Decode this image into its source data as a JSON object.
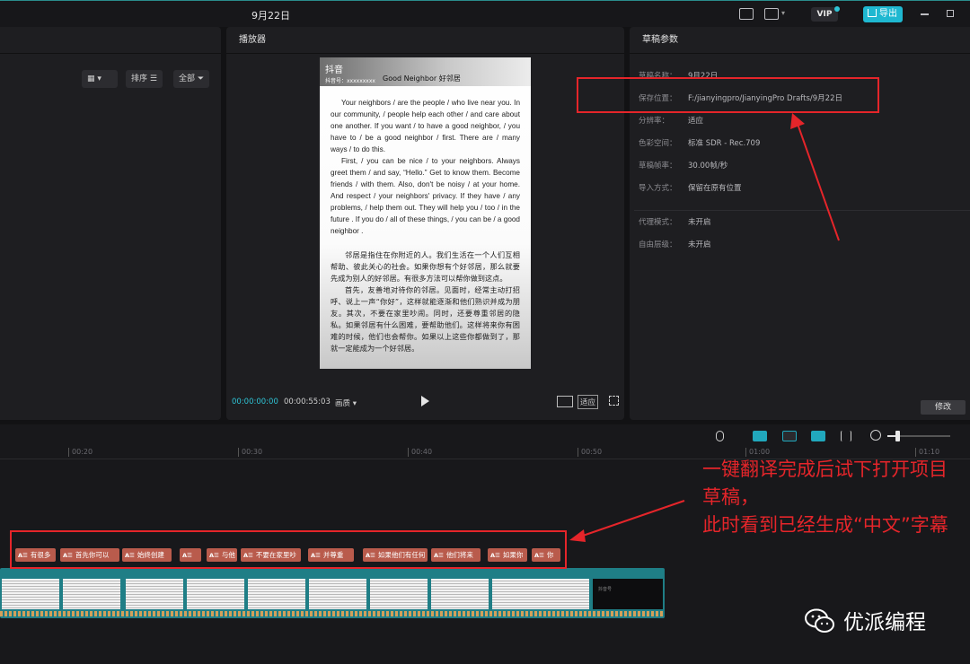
{
  "app": {
    "title": "9月22日",
    "export_label": "导出",
    "vip_label": "VIP"
  },
  "left_panel": {
    "sort_label": "排序",
    "all_label": "全部"
  },
  "player": {
    "title": "播放器",
    "time_current": "00:00:00:00",
    "time_total": "00:00:55:03",
    "quality_label": "画质",
    "fit_label": "适应"
  },
  "preview": {
    "logo": "抖音",
    "user_id": "抖音号：xxxxxxxxx",
    "heading": "Good Neighbor  好邻居",
    "en_para1": "Your neighbors / are the people / who live near you. In our community, / people help each other / and care about one another. If you want / to have a good neighbor, / you have to / be a good neighbor / first. There are / many ways / to do this.",
    "en_para2": "First, / you can be nice / to your neighbors. Always greet them / and say, “Hello.” Get to know them. Become friends / with them. Also, don't be noisy / at your home. And respect / your neighbors' privacy. If they have / any problems, / help them out. They will help you / too / in the future . If you do / all of these things, / you can be / a good neighbor .",
    "cn_para1": "邻居是指住在你附近的人。我们生活在一个人们互相帮助、彼此关心的社会。如果你想有个好邻居，那么就要先成为别人的好邻居。有很多方法可以帮你做到这点。",
    "cn_para2": "首先，友善地对待你的邻居。见面时，经常主动打招呼、说上一声“你好”，这样就能逐渐和他们熟识并成为朋友。其次，不要在家里吵闹。同时，还要尊重邻居的隐私。如果邻居有什么困难，要帮助他们。这样将来你有困难的时候，他们也会帮你。如果以上这些你都做到了，那就一定能成为一个好邻居。"
  },
  "draft": {
    "title": "草稿参数",
    "rows": [
      {
        "label": "草稿名称：",
        "value": "9月22日"
      },
      {
        "label": "保存位置：",
        "value": "F:/jianyingpro/JianyingPro Drafts/9月22日"
      },
      {
        "label": "分辨率：",
        "value": "适应"
      },
      {
        "label": "色彩空间：",
        "value": "标准 SDR - Rec.709"
      },
      {
        "label": "草稿帧率：",
        "value": "30.00帧/秒"
      },
      {
        "label": "导入方式：",
        "value": "保留在原有位置"
      },
      {
        "label": "代理模式：",
        "value": "未开启"
      },
      {
        "label": "自由层级：",
        "value": "未开启"
      }
    ],
    "modify_label": "修改"
  },
  "timeline": {
    "ticks": [
      "00:20",
      "00:30",
      "00:40",
      "00:50",
      "01:00",
      "01:10"
    ],
    "clip_tag": "A☰",
    "subtitle_clips": [
      "有很多",
      "首先你可以",
      "始终创建",
      "",
      "与他",
      "不要在家里吵",
      "并尊重",
      "如果他们有任何",
      "他们将来",
      "如果你",
      "你"
    ],
    "end_frame_text": "抖音号"
  },
  "annotation": {
    "line1": "一键翻译完成后试下打开项目草稿，",
    "line2": "此时看到已经生成“中文”字幕"
  },
  "watermark": "优派编程",
  "colors": {
    "accent": "#2ec4d6",
    "annotation_red": "#e5252a",
    "subtitle_clip": "#b95b4c",
    "video_track": "#1f7e86"
  }
}
